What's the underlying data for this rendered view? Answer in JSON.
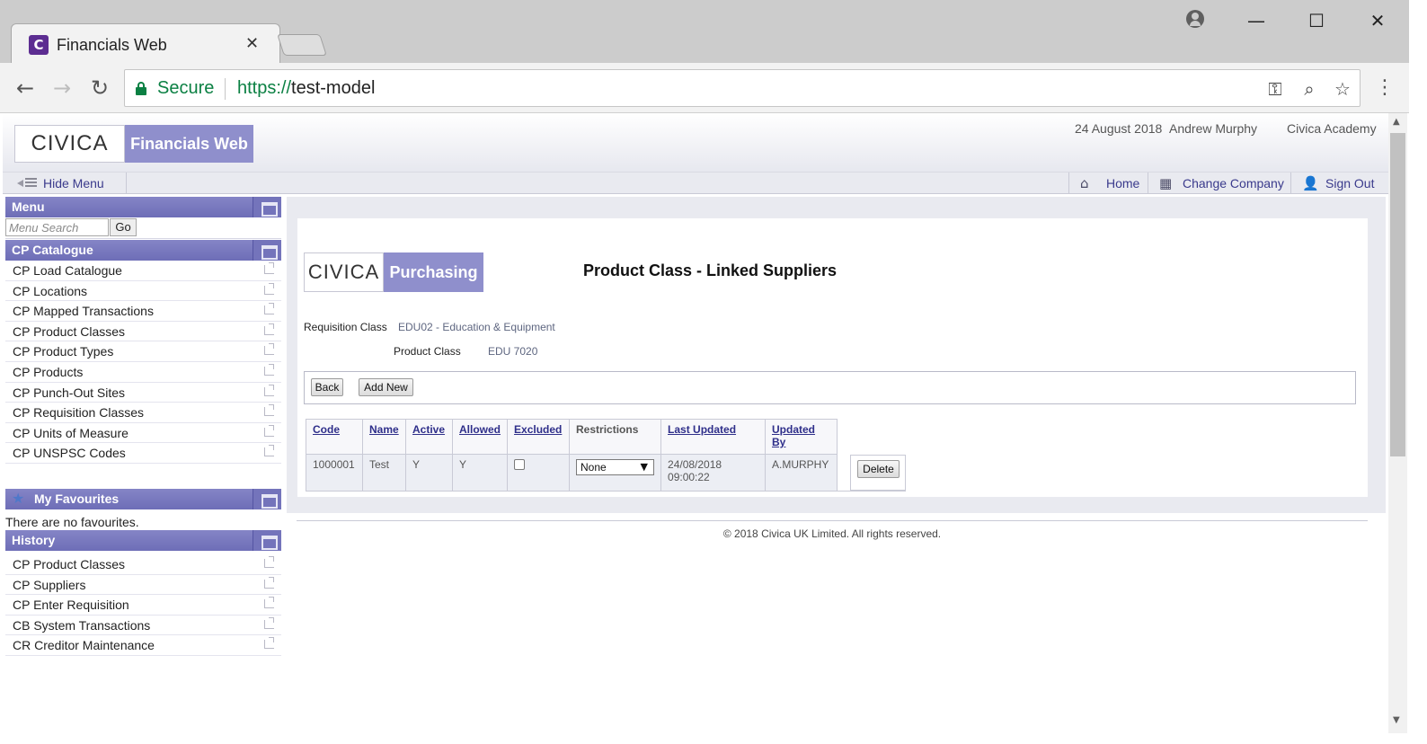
{
  "browser": {
    "tab_title": "Financials Web",
    "favicon_letter": "C",
    "tab_close": "✕",
    "secure_label": "Secure",
    "url_scheme": "https://",
    "url_host": "test-model"
  },
  "header": {
    "logo_brand": "CIVICA",
    "logo_product": "Financials Web",
    "date": "24 August 2018",
    "user": "Andrew Murphy",
    "organisation": "Civica Academy"
  },
  "navbar": {
    "hide_menu": "Hide Menu",
    "home": "Home",
    "change_company": "Change Company",
    "sign_out": "Sign Out"
  },
  "sidebar": {
    "menu_title": "Menu",
    "search_placeholder": "Menu Search",
    "search_button": "Go",
    "category_title": "CP Catalogue",
    "items": [
      {
        "label": "CP Load Catalogue"
      },
      {
        "label": "CP Locations"
      },
      {
        "label": "CP Mapped Transactions"
      },
      {
        "label": "CP Product Classes"
      },
      {
        "label": "CP Product Types"
      },
      {
        "label": "CP Products"
      },
      {
        "label": "CP Punch-Out Sites"
      },
      {
        "label": "CP Requisition Classes"
      },
      {
        "label": "CP Units of Measure"
      },
      {
        "label": "CP UNSPSC Codes"
      }
    ],
    "favourites_title": "My Favourites",
    "favourites_empty": "There are no favourites.",
    "history_title": "History",
    "history": [
      {
        "label": "CP Product Classes"
      },
      {
        "label": "CP Suppliers"
      },
      {
        "label": "CP Enter Requisition"
      },
      {
        "label": "CB System Transactions"
      },
      {
        "label": "CR Creditor Maintenance"
      }
    ]
  },
  "main": {
    "logo_brand": "CIVICA",
    "logo_product": "Purchasing",
    "title": "Product Class - Linked Suppliers",
    "requisition_class_label": "Requisition Class",
    "requisition_class_value": "EDU02 - Education & Equipment",
    "product_class_label": "Product Class",
    "product_class_value": "EDU 7020",
    "back_button": "Back",
    "add_new_button": "Add New",
    "table": {
      "headers": {
        "code": "Code",
        "name": "Name",
        "active": "Active",
        "allowed": "Allowed",
        "excluded": "Excluded",
        "restrictions": "Restrictions",
        "last_updated": "Last Updated",
        "updated_by_1": "Updated",
        "updated_by_2": "By"
      },
      "rows": [
        {
          "code": "1000001",
          "name": "Test",
          "active": "Y",
          "allowed": "Y",
          "excluded": false,
          "restrictions": "None",
          "last_updated_date": "24/08/2018",
          "last_updated_time": "09:00:22",
          "updated_by": "A.MURPHY",
          "delete_button": "Delete"
        }
      ]
    },
    "footer": "© 2018 Civica UK Limited. All rights reserved."
  }
}
